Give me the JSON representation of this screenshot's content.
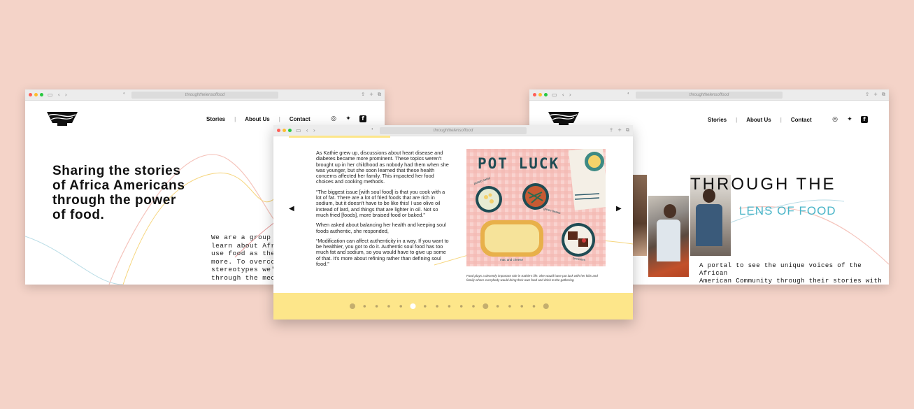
{
  "colors": {
    "background": "#f4d3c8",
    "accent_yellow": "#fde68a",
    "accent_teal": "#4ab5c8"
  },
  "url": "throughthelensoffood",
  "nav": {
    "stories": "Stories",
    "about": "About Us",
    "contact": "Contact"
  },
  "social_icons": [
    "instagram-icon",
    "twitter-icon",
    "facebook-icon"
  ],
  "left_window": {
    "hero_title": "Sharing the stories\nof Africa Americans\nthrough the power\nof food.",
    "body": "We are a group of c\nlearn about African\nuse food as the ent\nmore. To overcome\nstereotypes we've s\nthrough the media,"
  },
  "center_window": {
    "paragraphs": [
      "As Kathie grew up, discussions about heart disease and diabetes became more prominent. These topics weren't brought up in her childhood as nobody had them when she was younger, but she soon learned that these health concerns affected her family. This impacted her food choices and cooking methods.",
      "“The biggest issue [with soul food] is that you cook with a lot of fat. There are a lot of fried foods that are rich in sodium, but it doesn't have to be like this! I use olive oil instead of lard, and things that are lighter in oil. Not so much fried [foods], more braised food or baked.”",
      "When asked about balancing her health and keeping soul foods authentic, she responded,",
      "“Modification can affect authenticity in a way. If you want to be healthier, you got to do it. Authentic soul food has too much fat and sodium, so you would have to give up some of that. It's more about refining rather than defining soul food.”"
    ],
    "illustration": {
      "title": "POT LUCK",
      "labels": [
        "potato salad",
        "green beans",
        "mac and cheese",
        "brownies"
      ]
    },
    "caption": "Food plays a decently important role in Kathie's life. She would have pot luck with her kids and family where everybody would bring their own food and drink to the gathering.",
    "pager_dots": 17,
    "active_dot": 5
  },
  "right_window": {
    "title_line1": "THROUGH THE",
    "title_line2": "LENS OF FOOD",
    "portal_text": "A portal to see the unique voices of the African\nAmerican Community through their stories with\na focus on food in their life. The goal is to"
  }
}
